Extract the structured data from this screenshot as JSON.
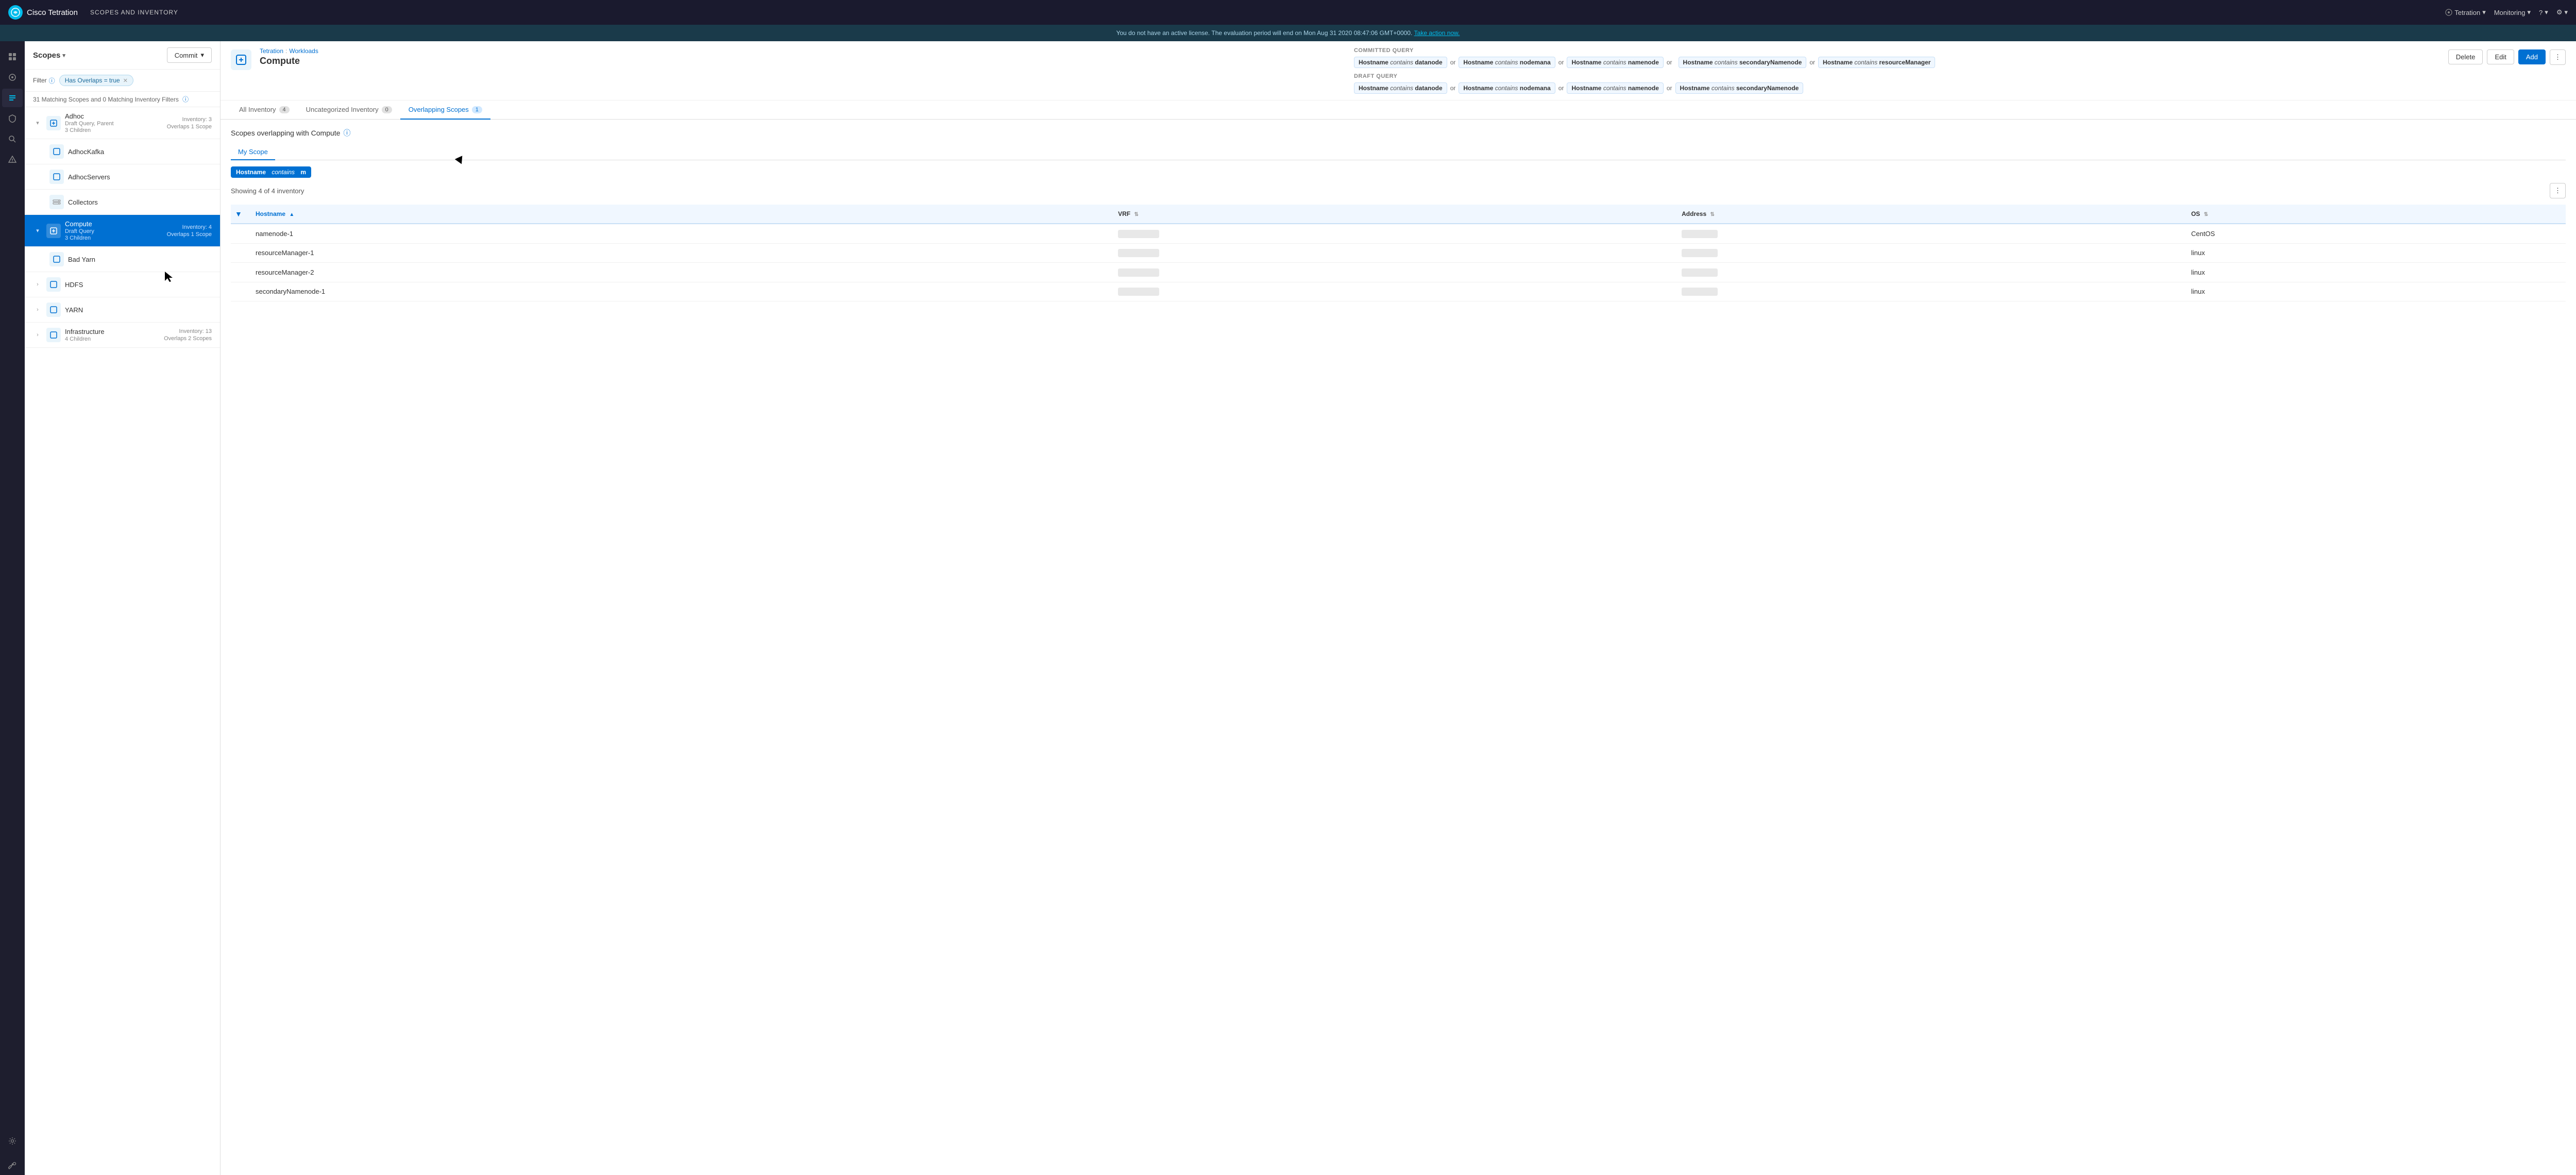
{
  "topNav": {
    "logoText": "Cisco Tetration",
    "appTitle": "SCOPES AND INVENTORY",
    "tetrationLabel": "Tetration",
    "monitoringLabel": "Monitoring",
    "helpLabel": "?",
    "settingsLabel": "⚙"
  },
  "licenseBar": {
    "text": "You do not have an active license. The evaluation period will end on Mon Aug 31 2020 08:47:06 GMT+0000.",
    "linkText": "Take action now."
  },
  "scopesPanel": {
    "title": "Scopes",
    "commitLabel": "Commit",
    "filterLabel": "Filter",
    "filterTag": "Has Overlaps = true",
    "matchingText": "31 Matching Scopes and 0 Matching Inventory Filters",
    "scopes": [
      {
        "name": "Adhoc",
        "sub": "Draft Query, Parent",
        "children": "3 Children",
        "inventory": "Inventory: 3",
        "overlaps": "Overlaps 1 Scope",
        "expanded": true,
        "level": 0
      },
      {
        "name": "AdhocKafka",
        "level": 1,
        "isChild": true
      },
      {
        "name": "AdhocServers",
        "level": 1,
        "isChild": true
      },
      {
        "name": "Collectors",
        "level": 1,
        "isChild": true
      },
      {
        "name": "Compute",
        "sub": "Draft Query",
        "children": "3 Children",
        "inventory": "Inventory: 4",
        "overlaps": "Overlaps 1 Scope",
        "selected": true,
        "expanded": true,
        "level": 0
      },
      {
        "name": "Bad Yarn",
        "level": 1,
        "isChild": true
      },
      {
        "name": "HDFS",
        "level": 0,
        "hasExpand": true
      },
      {
        "name": "YARN",
        "level": 0,
        "hasExpand": true
      },
      {
        "name": "Infrastructure",
        "sub": "4 Children",
        "inventory": "Inventory: 13",
        "overlaps": "Overlaps 2 Scopes",
        "level": 0,
        "hasExpand": true
      }
    ]
  },
  "rightPanel": {
    "breadcrumb": {
      "part1": "Tetration",
      "sep": ":",
      "part2": "Workloads"
    },
    "scopeName": "Compute",
    "committedQuery": {
      "label": "Committed Query",
      "tags": [
        {
          "text": "Hostname",
          "italic": "contains",
          "value": "datanode"
        },
        {
          "or": true
        },
        {
          "text": "Hostname",
          "italic": "contains",
          "value": "nodemana"
        },
        {
          "or": true
        },
        {
          "text": "Hostname",
          "italic": "contains",
          "value": "namenode"
        },
        {
          "or": true
        },
        {
          "text": "Hostname",
          "italic": "contains",
          "value": "secondaryNamenode"
        },
        {
          "or": true
        },
        {
          "text": "Hostname",
          "italic": "contains",
          "value": "resourceManager"
        }
      ]
    },
    "draftQuery": {
      "label": "Draft Query",
      "tags": [
        {
          "text": "Hostname",
          "italic": "contains",
          "value": "datanode"
        },
        {
          "or": true
        },
        {
          "text": "Hostname",
          "italic": "contains",
          "value": "nodemana"
        },
        {
          "or": true
        },
        {
          "text": "Hostname",
          "italic": "contains",
          "value": "namenode"
        },
        {
          "or": true
        },
        {
          "text": "Hostname",
          "italic": "contains",
          "value": "secondaryNamenode"
        }
      ]
    },
    "deleteLabel": "Delete",
    "editLabel": "Edit",
    "addLabel": "Add",
    "tabs": [
      {
        "label": "All Inventory",
        "count": "4",
        "active": false
      },
      {
        "label": "Uncategorized Inventory",
        "count": "0",
        "active": false
      },
      {
        "label": "Overlapping Scopes",
        "count": "1",
        "active": true
      }
    ],
    "overlapTitle": "Scopes overlapping with Compute",
    "subTabs": [
      {
        "label": "My Scope",
        "active": true
      }
    ],
    "filterTag": {
      "field": "Hostname",
      "op": "contains",
      "value": "m"
    },
    "showingText": "Showing 4 of 4 inventory",
    "tableHeaders": [
      {
        "label": "Hostname",
        "sorted": true
      },
      {
        "label": "VRF"
      },
      {
        "label": "Address"
      },
      {
        "label": "OS"
      }
    ],
    "tableRows": [
      {
        "hostname": "namenode-1",
        "vrf": "",
        "address": "",
        "os": "CentOS"
      },
      {
        "hostname": "resourceManager-1",
        "vrf": "",
        "address": "",
        "os": "linux"
      },
      {
        "hostname": "resourceManager-2",
        "vrf": "",
        "address": "",
        "os": "linux"
      },
      {
        "hostname": "secondaryNamenode-1",
        "vrf": "",
        "address": "",
        "os": "linux"
      }
    ]
  }
}
